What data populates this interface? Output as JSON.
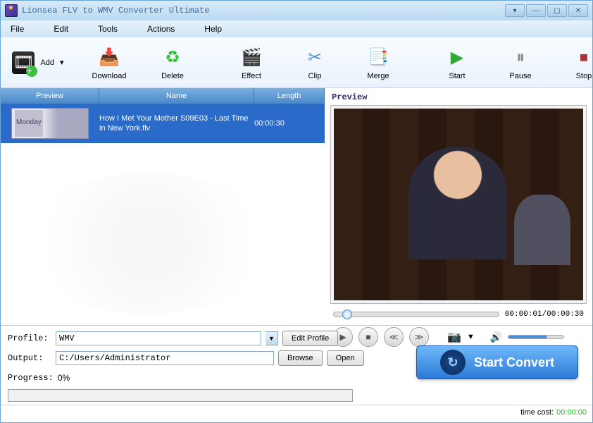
{
  "window": {
    "title": "Lionsea FLV to WMV Converter Ultimate"
  },
  "menu": {
    "file": "File",
    "edit": "Edit",
    "tools": "Tools",
    "actions": "Actions",
    "help": "Help"
  },
  "toolbar": {
    "add": "Add",
    "download": "Download",
    "delete": "Delete",
    "effect": "Effect",
    "clip": "Clip",
    "merge": "Merge",
    "start": "Start",
    "pause": "Pause",
    "stop": "Stop"
  },
  "columns": {
    "preview": "Preview",
    "name": "Name",
    "length": "Length"
  },
  "list": {
    "row1": {
      "thumb_text": "Monday",
      "name": "How I Met Your Mother S09E03 - Last Time in New York.flv",
      "length": "00:00:30"
    }
  },
  "preview": {
    "label": "Preview",
    "time": "00:00:01/00:00:30"
  },
  "form": {
    "profile_label": "Profile:",
    "profile_value": "WMV",
    "edit_profile": "Edit Profile",
    "output_label": "Output:",
    "output_value": "C:/Users/Administrator",
    "browse": "Browse",
    "open": "Open",
    "progress_label": "Progress:",
    "progress_value": "0%"
  },
  "convert": {
    "label": "Start Convert"
  },
  "footer": {
    "timecost_label": "time cost:",
    "timecost_value": "00:00:00"
  },
  "colors": {
    "accent": "#2a7ad8"
  }
}
